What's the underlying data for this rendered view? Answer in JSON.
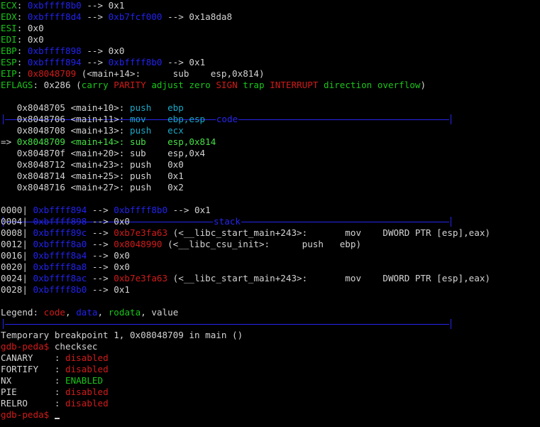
{
  "colors": {
    "register_name": "#19c519",
    "address": "#2222ee",
    "code_addr": "#d21a1a",
    "text": "#d3d3d3",
    "mnemonic": "#1aa7c6",
    "separator": "#2626ee"
  },
  "registers": [
    {
      "name": "ECX",
      "sep": ": ",
      "chain": "0xbffff8b0",
      "rest": " --> 0x1"
    },
    {
      "name": "EDX",
      "sep": ": ",
      "chain": "0xbffff8d4",
      "mid": " --> ",
      "chain2": "0xb7fcf000",
      "rest": " --> 0x1a8da8"
    },
    {
      "name": "ESI",
      "sep": ": ",
      "rest": "0x0"
    },
    {
      "name": "EDI",
      "sep": ": ",
      "rest": "0x0"
    },
    {
      "name": "EBP",
      "sep": ": ",
      "chain": "0xbffff898",
      "rest": " --> 0x0"
    },
    {
      "name": "ESP",
      "sep": ": ",
      "chain": "0xbffff894",
      "mid": " --> ",
      "chain2": "0xbffff8b0",
      "rest": " --> 0x1"
    },
    {
      "name": "EIP",
      "sep": ": ",
      "code": "0x8048709",
      "rest": " (<main+14>:      sub    esp,0x814)"
    }
  ],
  "eflags": {
    "name": "EFLAGS",
    "value": ": 0x286 (",
    "carry": "carry ",
    "parity": "PARITY ",
    "adjust": "adjust zero ",
    "sign": "SIGN ",
    "trap": "trap ",
    "interrupt": "INTERRUPT ",
    "direction": "direction overflow",
    "close": ")"
  },
  "sections": {
    "code": "code",
    "stack": "stack"
  },
  "code_lines": [
    {
      "prefix": "   ",
      "addr": "0x8048705 <main+10>: ",
      "op": "push   ",
      "arg": "ebp",
      "current": false
    },
    {
      "prefix": "   ",
      "addr": "0x8048706 <main+11>: ",
      "op": "mov    ",
      "arg": "ebp,esp",
      "current": false
    },
    {
      "prefix": "   ",
      "addr": "0x8048708 <main+13>: ",
      "op": "push   ",
      "arg": "ecx",
      "current": false
    },
    {
      "prefix": "=> ",
      "addr": "0x8048709 <main+14>: ",
      "op": "sub    ",
      "arg": "esp,0x814",
      "current": true
    },
    {
      "prefix": "   ",
      "addr": "0x804870f <main+20>: ",
      "op": "sub    ",
      "arg": "esp,0x4",
      "current": false
    },
    {
      "prefix": "   ",
      "addr": "0x8048712 <main+23>: ",
      "op": "push   ",
      "arg": "0x0",
      "current": false
    },
    {
      "prefix": "   ",
      "addr": "0x8048714 <main+25>: ",
      "op": "push   ",
      "arg": "0x1",
      "current": false
    },
    {
      "prefix": "   ",
      "addr": "0x8048716 <main+27>: ",
      "op": "push   ",
      "arg": "0x2",
      "current": false
    }
  ],
  "stack_lines": [
    {
      "off": "0000| ",
      "addr": "0xbffff894",
      "a1": " --> ",
      "v1": "0xbffff8b0",
      "v1type": "data",
      "tail": " --> 0x1"
    },
    {
      "off": "0004| ",
      "addr": "0xbffff898",
      "a1": " --> ",
      "tail": "0x0"
    },
    {
      "off": "0008| ",
      "addr": "0xbffff89c",
      "a1": " --> ",
      "v1": "0xb7e3fa63",
      "v1type": "code",
      "tail": " (<__libc_start_main+243>:       mov    DWORD PTR [esp],eax)"
    },
    {
      "off": "0012| ",
      "addr": "0xbffff8a0",
      "a1": " --> ",
      "v1": "0x8048990",
      "v1type": "code",
      "tail": " (<__libc_csu_init>:      push   ebp)"
    },
    {
      "off": "0016| ",
      "addr": "0xbffff8a4",
      "a1": " --> ",
      "tail": "0x0"
    },
    {
      "off": "0020| ",
      "addr": "0xbffff8a8",
      "a1": " --> ",
      "tail": "0x0"
    },
    {
      "off": "0024| ",
      "addr": "0xbffff8ac",
      "a1": " --> ",
      "v1": "0xb7e3fa63",
      "v1type": "code",
      "tail": " (<__libc_start_main+243>:       mov    DWORD PTR [esp],eax)"
    },
    {
      "off": "0028| ",
      "addr": "0xbffff8b0",
      "a1": " --> ",
      "tail": "0x1"
    }
  ],
  "legend": {
    "label": "Legend: ",
    "code": "code",
    "comma1": ", ",
    "data": "data",
    "comma2": ", ",
    "rodata": "rodata",
    "comma3": ", ",
    "value": "value"
  },
  "breakpoint_msg": "Temporary breakpoint 1, 0x08048709 in main ()",
  "prompt": "gdb-peda$",
  "command": " checksec",
  "checksec": [
    {
      "key": "CANARY    : ",
      "value": "disabled",
      "status": "disabled"
    },
    {
      "key": "FORTIFY   : ",
      "value": "disabled",
      "status": "disabled"
    },
    {
      "key": "NX        : ",
      "value": "ENABLED",
      "status": "enabled"
    },
    {
      "key": "PIE       : ",
      "value": "disabled",
      "status": "disabled"
    },
    {
      "key": "RELRO     : ",
      "value": "disabled",
      "status": "disabled"
    }
  ],
  "final_prompt": "gdb-peda$",
  "final_after": " "
}
